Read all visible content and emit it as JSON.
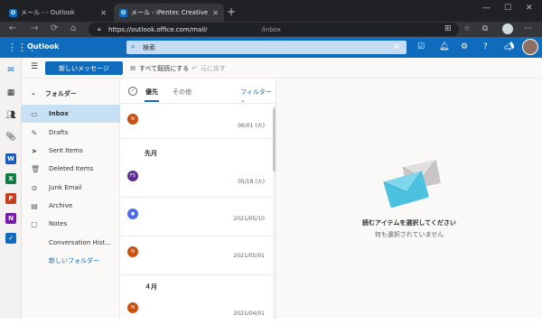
{
  "browser": {
    "tabs": [
      {
        "title": "メール -        - Outlook",
        "active": false
      },
      {
        "title": "メール - iPentec Creative - Outlook",
        "active": true
      }
    ],
    "new_tab": "+",
    "url_host": "https://outlook.office.com/mail/",
    "url_path": "/inbox"
  },
  "header": {
    "app_name": "Outlook",
    "search_placeholder": "検索"
  },
  "commands": {
    "new_message": "新しいメッセージ",
    "mark_all_read": "すべて既読にする",
    "undo": "元に戻す"
  },
  "folders": {
    "heading": "フォルダー",
    "items": [
      {
        "label": "Inbox",
        "icon": "inbox-icon",
        "selected": true
      },
      {
        "label": "Drafts",
        "icon": "pencil-icon",
        "selected": false
      },
      {
        "label": "Sent Items",
        "icon": "send-icon",
        "selected": false
      },
      {
        "label": "Deleted Items",
        "icon": "trash-icon",
        "selected": false
      },
      {
        "label": "Junk Email",
        "icon": "block-icon",
        "selected": false
      },
      {
        "label": "Archive",
        "icon": "archive-icon",
        "selected": false
      },
      {
        "label": "Notes",
        "icon": "note-icon",
        "selected": false
      },
      {
        "label": "Conversation Hist...",
        "icon": "none",
        "selected": false
      }
    ],
    "new_folder": "新しいフォルダー"
  },
  "message_list": {
    "tabs": [
      "優先",
      "その他"
    ],
    "filter": "フィルター",
    "groups": [
      "先月",
      "４月"
    ],
    "messages": [
      {
        "avatar": "N",
        "color": "#ca5010",
        "date": "06/01 (火)"
      },
      {
        "avatar": "FS",
        "color": "#5c2e91",
        "date": "05/18 (火)"
      },
      {
        "avatar": "person",
        "color": "#4f6bed",
        "date": "2021/05/10"
      },
      {
        "avatar": "N",
        "color": "#ca5010",
        "date": "2021/05/01"
      },
      {
        "avatar": "N",
        "color": "#ca5010",
        "date": "2021/04/01"
      }
    ]
  },
  "reading_pane": {
    "empty_title": "読むアイテムを選択してください",
    "empty_subtitle": "何も選択されていません"
  },
  "colors": {
    "accent": "#0f6cbd",
    "selected_folder": "#c7e0f4"
  }
}
